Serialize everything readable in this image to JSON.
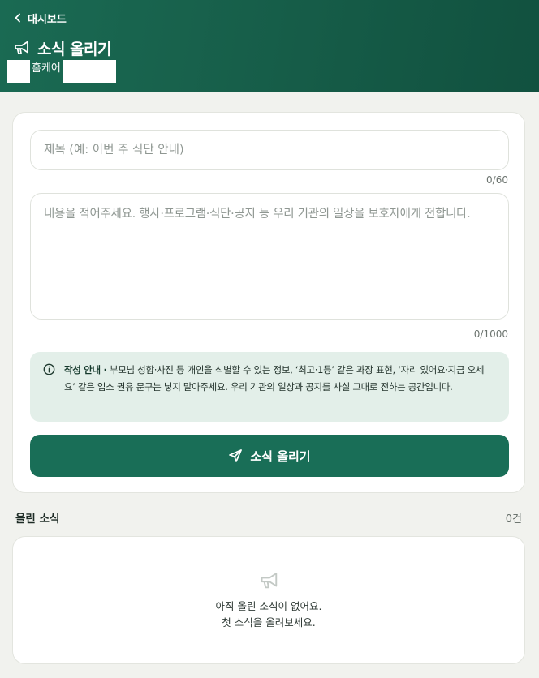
{
  "header": {
    "back_label": "대시보드",
    "title": "소식 올리기",
    "org_name": "홈케어"
  },
  "form": {
    "title_placeholder": "제목 (예: 이번 주 식단 안내)",
    "title_counter": "0/60",
    "body_placeholder": "내용을 적어주세요. 행사·프로그램·식단·공지 등 우리 기관의 일상을 보호자에게 전합니다.",
    "body_counter": "0/1000",
    "notice_head": "작성 안내 ·",
    "notice_text": " 부모님 성함·사진 등 개인을 식별할 수 있는 정보, ‘최고·1등’ 같은 과장 표현, ‘자리 있어요·지금 오세요’ 같은 입소 권유 문구는 넣지 말아주세요. 우리 기관의 일상과 공지를 사실 그대로 전하는 공간입니다.",
    "submit_label": "소식 올리기"
  },
  "posts": {
    "section_title": "올린 소식",
    "count": "0건",
    "empty_line1": "아직 올린 소식이 없어요.",
    "empty_line2": "첫 소식을 올려보세요."
  },
  "colors": {
    "header_bg": "#175f4a",
    "accent": "#196e57",
    "notice_bg": "#e3efe9",
    "page_bg": "#f1f2ee"
  },
  "icons": {
    "back": "chevron-left-icon",
    "title": "megaphone-icon",
    "notice": "info-icon",
    "submit": "send-icon",
    "empty": "megaphone-icon"
  }
}
